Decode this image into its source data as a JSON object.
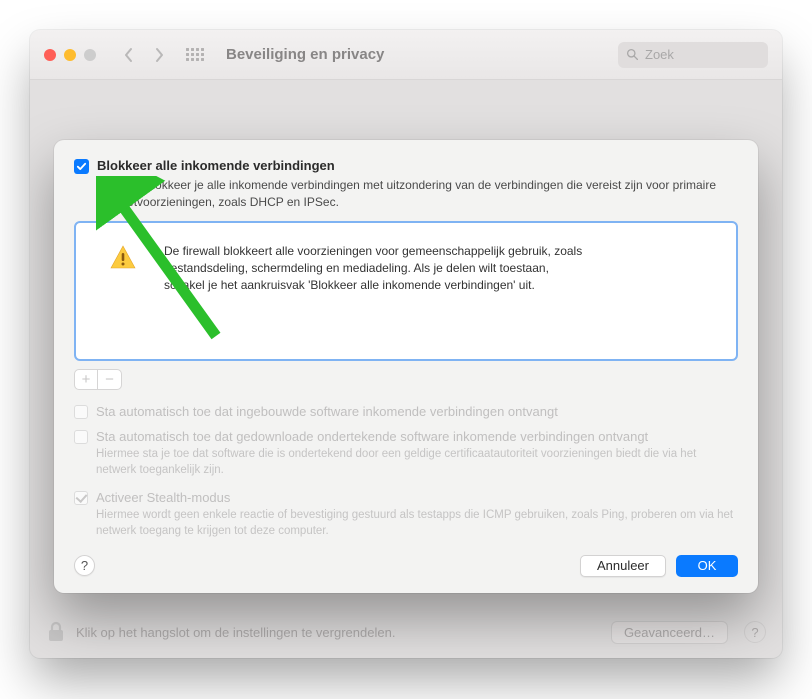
{
  "titlebar": {
    "title": "Beveiliging en privacy",
    "search_placeholder": "Zoek"
  },
  "sheet": {
    "block_incoming": {
      "label": "Blokkeer alle inkomende verbindingen",
      "description": "Hiermee blokkeer je alle inkomende verbindingen met uitzondering van de verbindingen die vereist zijn voor primaire internetvoorzieningen, zoals DHCP en IPSec."
    },
    "info_text": "De firewall blokkeert alle voorzieningen voor gemeenschappelijk gebruik, zoals bestandsdeling, schermdeling en mediadeling. Als je delen wilt toestaan, schakel je het aankruisvak 'Blokkeer alle inkomende verbindingen' uit.",
    "opt_builtin": "Sta automatisch toe dat ingebouwde software inkomende verbindingen ontvangt",
    "opt_signed": {
      "label": "Sta automatisch toe dat gedownloade ondertekende software inkomende verbindingen ontvangt",
      "description": "Hiermee sta je toe dat software die is ondertekend door een geldige certificaatautoriteit voorzieningen biedt die via het netwerk toegankelijk zijn."
    },
    "opt_stealth": {
      "label": "Activeer Stealth-modus",
      "description": "Hiermee wordt geen enkele reactie of bevestiging gestuurd als testapps die ICMP gebruiken, zoals Ping, proberen om via het netwerk toegang te krijgen tot deze computer."
    },
    "cancel": "Annuleer",
    "ok": "OK",
    "help": "?"
  },
  "window": {
    "lock_text": "Klik op het hangslot om de instellingen te vergrendelen.",
    "advanced": "Geavanceerd…",
    "help": "?"
  }
}
